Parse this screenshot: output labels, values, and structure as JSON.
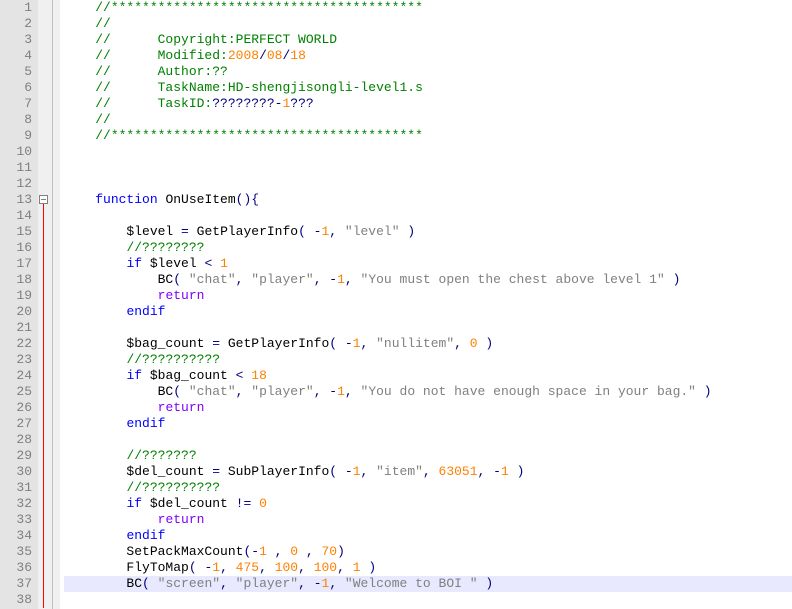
{
  "lines": [
    {
      "n": 1,
      "seg": [
        {
          "c": "cm",
          "t": "//****************************************"
        }
      ]
    },
    {
      "n": 2,
      "seg": [
        {
          "c": "cm",
          "t": "//"
        }
      ]
    },
    {
      "n": 3,
      "seg": [
        {
          "c": "cm",
          "t": "//      Copyright:PERFECT WORLD"
        }
      ]
    },
    {
      "n": 4,
      "seg": [
        {
          "c": "cm",
          "t": "//      Modified:"
        },
        {
          "c": "nu",
          "t": "2008"
        },
        {
          "c": "op",
          "t": "/"
        },
        {
          "c": "nu",
          "t": "08"
        },
        {
          "c": "op",
          "t": "/"
        },
        {
          "c": "nu",
          "t": "18"
        }
      ]
    },
    {
      "n": 5,
      "seg": [
        {
          "c": "cm",
          "t": "//      Author:??"
        }
      ]
    },
    {
      "n": 6,
      "seg": [
        {
          "c": "cm",
          "t": "//      TaskName:HD-shengjisongli-level1.s"
        }
      ]
    },
    {
      "n": 7,
      "seg": [
        {
          "c": "cm",
          "t": "//      TaskID:"
        },
        {
          "c": "op",
          "t": "????????-"
        },
        {
          "c": "nu",
          "t": "1"
        },
        {
          "c": "op",
          "t": "???"
        }
      ]
    },
    {
      "n": 8,
      "seg": [
        {
          "c": "cm",
          "t": "//"
        }
      ]
    },
    {
      "n": 9,
      "seg": [
        {
          "c": "cm",
          "t": "//****************************************"
        }
      ]
    },
    {
      "n": 10,
      "seg": []
    },
    {
      "n": 11,
      "seg": []
    },
    {
      "n": 12,
      "seg": []
    },
    {
      "n": 13,
      "seg": [
        {
          "c": "kw",
          "t": "function"
        },
        {
          "c": "va",
          "t": " OnUseItem"
        },
        {
          "c": "op",
          "t": "(){"
        }
      ],
      "fold": true
    },
    {
      "n": 14,
      "seg": []
    },
    {
      "n": 15,
      "seg": [
        {
          "c": "va",
          "t": "    $level "
        },
        {
          "c": "op",
          "t": "="
        },
        {
          "c": "va",
          "t": " GetPlayerInfo"
        },
        {
          "c": "op",
          "t": "( -"
        },
        {
          "c": "nu",
          "t": "1"
        },
        {
          "c": "op",
          "t": ", "
        },
        {
          "c": "st",
          "t": "\"level\""
        },
        {
          "c": "op",
          "t": " )"
        }
      ]
    },
    {
      "n": 16,
      "seg": [
        {
          "c": "va",
          "t": "    "
        },
        {
          "c": "cm",
          "t": "//????????"
        }
      ]
    },
    {
      "n": 17,
      "seg": [
        {
          "c": "va",
          "t": "    "
        },
        {
          "c": "kw",
          "t": "if"
        },
        {
          "c": "va",
          "t": " $level "
        },
        {
          "c": "op",
          "t": "< "
        },
        {
          "c": "nu",
          "t": "1"
        }
      ]
    },
    {
      "n": 18,
      "seg": [
        {
          "c": "va",
          "t": "        BC"
        },
        {
          "c": "op",
          "t": "( "
        },
        {
          "c": "st",
          "t": "\"chat\""
        },
        {
          "c": "op",
          "t": ", "
        },
        {
          "c": "st",
          "t": "\"player\""
        },
        {
          "c": "op",
          "t": ", -"
        },
        {
          "c": "nu",
          "t": "1"
        },
        {
          "c": "op",
          "t": ", "
        },
        {
          "c": "st",
          "t": "\"You must open the chest above level 1\""
        },
        {
          "c": "op",
          "t": " )"
        }
      ]
    },
    {
      "n": 19,
      "seg": [
        {
          "c": "va",
          "t": "        "
        },
        {
          "c": "rt",
          "t": "return"
        }
      ]
    },
    {
      "n": 20,
      "seg": [
        {
          "c": "va",
          "t": "    "
        },
        {
          "c": "kw",
          "t": "endif"
        }
      ]
    },
    {
      "n": 21,
      "seg": []
    },
    {
      "n": 22,
      "seg": [
        {
          "c": "va",
          "t": "    $bag_count "
        },
        {
          "c": "op",
          "t": "="
        },
        {
          "c": "va",
          "t": " GetPlayerInfo"
        },
        {
          "c": "op",
          "t": "( -"
        },
        {
          "c": "nu",
          "t": "1"
        },
        {
          "c": "op",
          "t": ", "
        },
        {
          "c": "st",
          "t": "\"nullitem\""
        },
        {
          "c": "op",
          "t": ", "
        },
        {
          "c": "nu",
          "t": "0"
        },
        {
          "c": "op",
          "t": " )"
        }
      ]
    },
    {
      "n": 23,
      "seg": [
        {
          "c": "va",
          "t": "    "
        },
        {
          "c": "cm",
          "t": "//??????????"
        }
      ]
    },
    {
      "n": 24,
      "seg": [
        {
          "c": "va",
          "t": "    "
        },
        {
          "c": "kw",
          "t": "if"
        },
        {
          "c": "va",
          "t": " $bag_count "
        },
        {
          "c": "op",
          "t": "< "
        },
        {
          "c": "nu",
          "t": "18"
        }
      ]
    },
    {
      "n": 25,
      "seg": [
        {
          "c": "va",
          "t": "        BC"
        },
        {
          "c": "op",
          "t": "( "
        },
        {
          "c": "st",
          "t": "\"chat\""
        },
        {
          "c": "op",
          "t": ", "
        },
        {
          "c": "st",
          "t": "\"player\""
        },
        {
          "c": "op",
          "t": ", -"
        },
        {
          "c": "nu",
          "t": "1"
        },
        {
          "c": "op",
          "t": ", "
        },
        {
          "c": "st",
          "t": "\"You do not have enough space in your bag.\""
        },
        {
          "c": "op",
          "t": " )"
        }
      ]
    },
    {
      "n": 26,
      "seg": [
        {
          "c": "va",
          "t": "        "
        },
        {
          "c": "rt",
          "t": "return"
        }
      ]
    },
    {
      "n": 27,
      "seg": [
        {
          "c": "va",
          "t": "    "
        },
        {
          "c": "kw",
          "t": "endif"
        }
      ]
    },
    {
      "n": 28,
      "seg": []
    },
    {
      "n": 29,
      "seg": [
        {
          "c": "va",
          "t": "    "
        },
        {
          "c": "cm",
          "t": "//???????"
        }
      ]
    },
    {
      "n": 30,
      "seg": [
        {
          "c": "va",
          "t": "    $del_count "
        },
        {
          "c": "op",
          "t": "="
        },
        {
          "c": "va",
          "t": " SubPlayerInfo"
        },
        {
          "c": "op",
          "t": "( -"
        },
        {
          "c": "nu",
          "t": "1"
        },
        {
          "c": "op",
          "t": ", "
        },
        {
          "c": "st",
          "t": "\"item\""
        },
        {
          "c": "op",
          "t": ", "
        },
        {
          "c": "nu",
          "t": "63051"
        },
        {
          "c": "op",
          "t": ", -"
        },
        {
          "c": "nu",
          "t": "1"
        },
        {
          "c": "op",
          "t": " )"
        }
      ]
    },
    {
      "n": 31,
      "seg": [
        {
          "c": "va",
          "t": "    "
        },
        {
          "c": "cm",
          "t": "//??????????"
        }
      ]
    },
    {
      "n": 32,
      "seg": [
        {
          "c": "va",
          "t": "    "
        },
        {
          "c": "kw",
          "t": "if"
        },
        {
          "c": "va",
          "t": " $del_count "
        },
        {
          "c": "op",
          "t": "!= "
        },
        {
          "c": "nu",
          "t": "0"
        }
      ]
    },
    {
      "n": 33,
      "seg": [
        {
          "c": "va",
          "t": "        "
        },
        {
          "c": "rt",
          "t": "return"
        }
      ]
    },
    {
      "n": 34,
      "seg": [
        {
          "c": "va",
          "t": "    "
        },
        {
          "c": "kw",
          "t": "endif"
        }
      ]
    },
    {
      "n": 35,
      "seg": [
        {
          "c": "va",
          "t": "    SetPackMaxCount"
        },
        {
          "c": "op",
          "t": "(-"
        },
        {
          "c": "nu",
          "t": "1"
        },
        {
          "c": "op",
          "t": " , "
        },
        {
          "c": "nu",
          "t": "0"
        },
        {
          "c": "op",
          "t": " , "
        },
        {
          "c": "nu",
          "t": "70"
        },
        {
          "c": "op",
          "t": ")"
        }
      ]
    },
    {
      "n": 36,
      "seg": [
        {
          "c": "va",
          "t": "    FlyToMap"
        },
        {
          "c": "op",
          "t": "( -"
        },
        {
          "c": "nu",
          "t": "1"
        },
        {
          "c": "op",
          "t": ", "
        },
        {
          "c": "nu",
          "t": "475"
        },
        {
          "c": "op",
          "t": ", "
        },
        {
          "c": "nu",
          "t": "100"
        },
        {
          "c": "op",
          "t": ", "
        },
        {
          "c": "nu",
          "t": "100"
        },
        {
          "c": "op",
          "t": ", "
        },
        {
          "c": "nu",
          "t": "1"
        },
        {
          "c": "op",
          "t": " )"
        }
      ]
    },
    {
      "n": 37,
      "seg": [
        {
          "c": "va",
          "t": "    BC"
        },
        {
          "c": "op",
          "t": "( "
        },
        {
          "c": "st",
          "t": "\"screen\""
        },
        {
          "c": "op",
          "t": ", "
        },
        {
          "c": "st",
          "t": "\"player\""
        },
        {
          "c": "op",
          "t": ", -"
        },
        {
          "c": "nu",
          "t": "1"
        },
        {
          "c": "op",
          "t": ", "
        },
        {
          "c": "st",
          "t": "\"Welcome to BOI \""
        },
        {
          "c": "op",
          "t": " )"
        }
      ],
      "hl": true
    },
    {
      "n": 38,
      "seg": []
    }
  ],
  "indent": "    "
}
